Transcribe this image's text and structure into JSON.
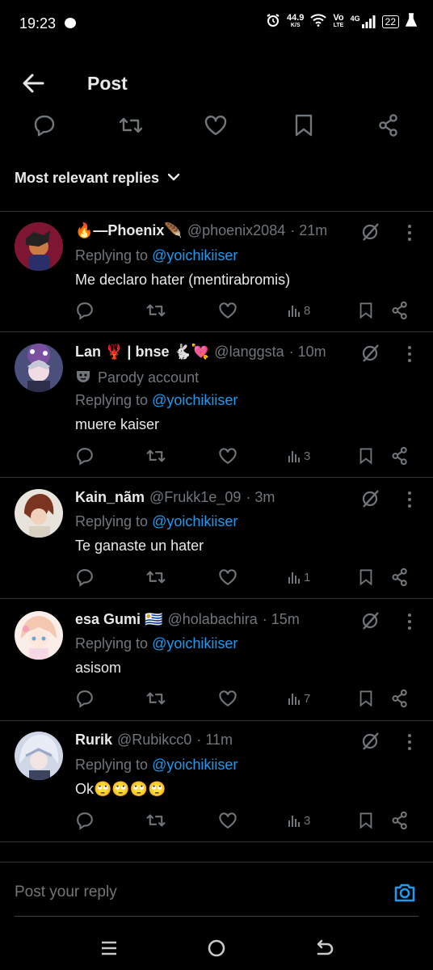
{
  "status": {
    "time": "19:23",
    "speed": "44.9",
    "speed_unit": "K/S",
    "vo": "Vo",
    "lte": "LTE",
    "network": "4G",
    "battery": "22"
  },
  "header": {
    "title": "Post"
  },
  "sort": {
    "label": "Most relevant replies"
  },
  "replies": [
    {
      "name": "🔥—Phoenix🪶",
      "handle": "@phoenix2084",
      "time": "· 21m",
      "parody": "",
      "replying_prefix": "Replying to",
      "replying_to": "@yoichikiiser",
      "text": "Me declaro hater (mentirabromis)",
      "views": "8"
    },
    {
      "name": "Lan 🦞 | bnse 🐇💘",
      "handle": "@langgsta",
      "time": "· 10m",
      "parody": "Parody account",
      "replying_prefix": "Replying to",
      "replying_to": "@yoichikiiser",
      "text": "muere kaiser",
      "views": "3"
    },
    {
      "name": "Kain_nãm",
      "handle": "@Frukk1e_09",
      "time": "· 3m",
      "parody": "",
      "replying_prefix": "Replying to",
      "replying_to": "@yoichikiiser",
      "text": "Te ganaste un hater",
      "views": "1"
    },
    {
      "name": "esa Gumi 🇺🇾",
      "handle": "@holabachira",
      "time": "· 15m",
      "parody": "",
      "replying_prefix": "Replying to",
      "replying_to": "@yoichikiiser",
      "text": "asisom",
      "views": "7"
    },
    {
      "name": "Rurik",
      "handle": "@Rubikcc0",
      "time": "· 11m",
      "parody": "",
      "replying_prefix": "Replying to",
      "replying_to": "@yoichikiiser",
      "text": "Ok🙄🙄🙄🙄",
      "views": "3"
    }
  ],
  "compose": {
    "placeholder": "Post your reply"
  },
  "colors": {
    "background": "#000000",
    "accent": "#1d9bf0",
    "muted": "#71767b",
    "text": "#e7e9ea",
    "divider": "#2f3336"
  }
}
